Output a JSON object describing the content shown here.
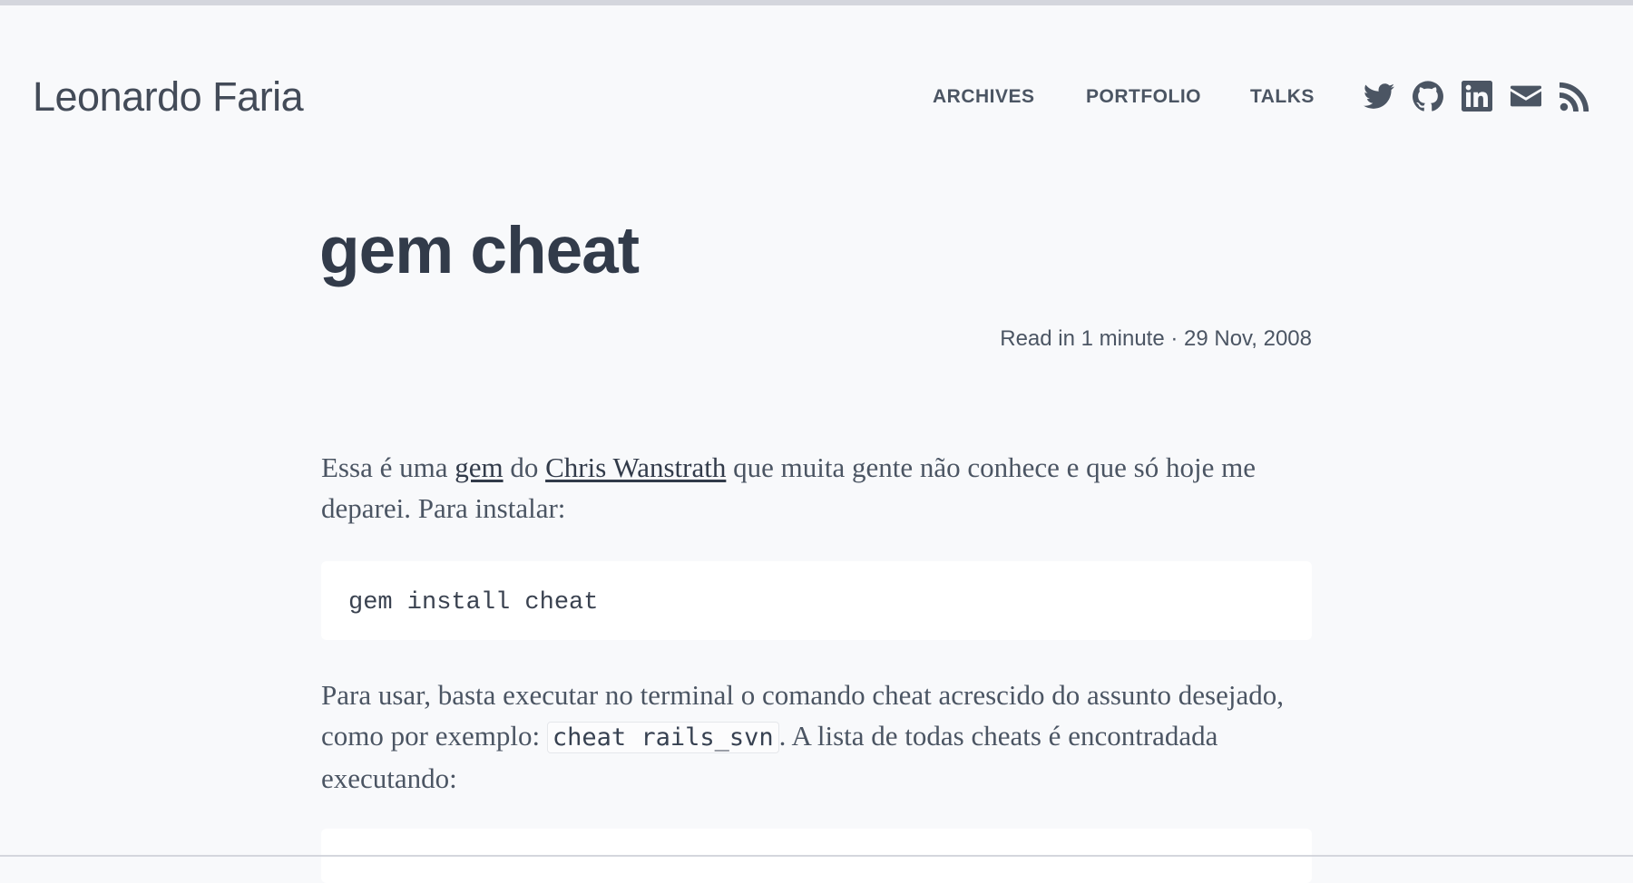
{
  "site": {
    "title": "Leonardo Faria"
  },
  "nav": {
    "items": [
      {
        "label": "ARCHIVES"
      },
      {
        "label": "PORTFOLIO"
      },
      {
        "label": "TALKS"
      }
    ]
  },
  "social": {
    "icons": [
      "twitter-icon",
      "github-icon",
      "linkedin-icon",
      "email-icon",
      "rss-icon"
    ],
    "color": "#4b5563"
  },
  "post": {
    "title": "gem cheat",
    "meta": "Read in 1 minute · 29 Nov, 2008",
    "p1": {
      "t1": "Essa é uma ",
      "link1": "gem",
      "t2": " do ",
      "link2": "Chris Wanstrath",
      "t3": " que muita gente não conhece e que só hoje me deparei. Para instalar:"
    },
    "code1": "gem install cheat",
    "p2": {
      "t1": "Para usar, basta executar no terminal o comando cheat acrescido do assunto desejado, como por exemplo: ",
      "code": "cheat rails_svn",
      "t2": ". A lista de todas cheats é encontradada executando:"
    },
    "code2": ""
  },
  "colors": {
    "background": "#f8f9fb",
    "title": "#323b4a",
    "text": "#4b5563",
    "code_bg": "#ffffff"
  }
}
